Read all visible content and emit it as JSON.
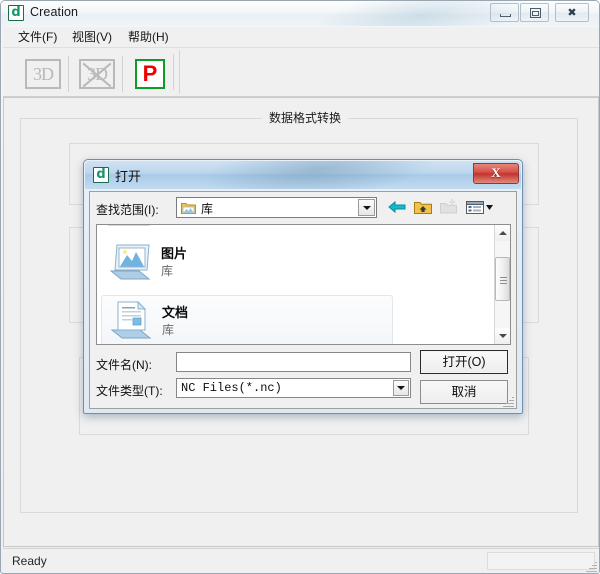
{
  "app": {
    "title": "Creation",
    "icon": "app-logo-icon",
    "window_controls": {
      "minimize": "minimize-icon",
      "maximize": "maximize-icon",
      "close": "close-icon"
    }
  },
  "menu": {
    "items": [
      {
        "label": "文件(F)"
      },
      {
        "label": "视图(V)"
      },
      {
        "label": "帮助(H)"
      }
    ]
  },
  "toolbar": {
    "buttons": [
      {
        "label": "3D",
        "name": "view-3d-button",
        "enabled": false
      },
      {
        "label": "3D",
        "name": "view-3d-off-button",
        "enabled": false
      },
      {
        "label": "P",
        "name": "plot-button",
        "enabled": true
      }
    ],
    "accent_red": "#ee0000",
    "accent_green": "#0f9c26"
  },
  "main": {
    "group_title": "数据格式转换"
  },
  "status": {
    "text": "Ready"
  },
  "dialog": {
    "title": "打开",
    "close_label": "X",
    "lookin": {
      "label": "查找范围(I):",
      "value": "库",
      "icon": "library-folder-icon"
    },
    "nav": {
      "back": "back-arrow-icon",
      "up": "up-folder-icon",
      "new_folder": "new-folder-icon",
      "views": "views-icon"
    },
    "files": [
      {
        "name": "",
        "sub": "",
        "partial": true
      },
      {
        "name": "图片",
        "sub": "库",
        "icon": "pictures-library-icon"
      },
      {
        "name": "文档",
        "sub": "库",
        "icon": "documents-library-icon"
      }
    ],
    "filename": {
      "label": "文件名(N):",
      "value": "",
      "placeholder": ""
    },
    "filetype": {
      "label": "文件类型(T):",
      "value": "NC Files(*.nc)"
    },
    "buttons": {
      "open": "打开(O)",
      "cancel": "取消"
    }
  }
}
